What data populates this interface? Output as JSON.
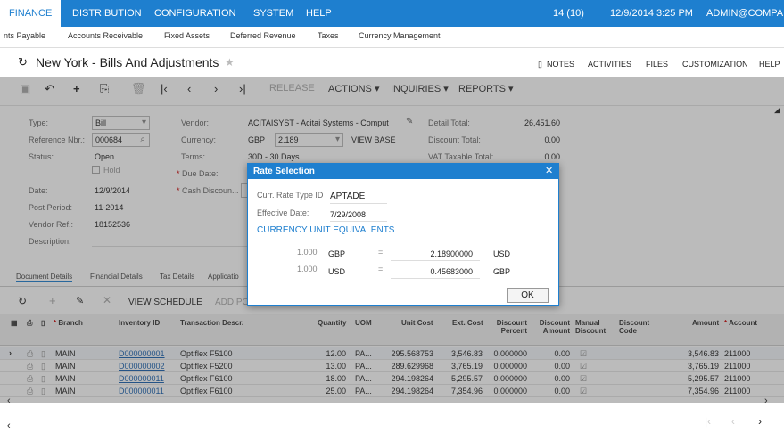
{
  "topbar": {
    "menus": [
      "FINANCE",
      "DISTRIBUTION",
      "CONFIGURATION",
      "SYSTEM",
      "HELP"
    ],
    "counter": "14 (10)",
    "datetime": "12/9/2014  3:25 PM",
    "user": "ADMIN@COMPAN"
  },
  "subtabs": [
    "nts Payable",
    "Accounts Receivable",
    "Fixed Assets",
    "Deferred Revenue",
    "Taxes",
    "Currency Management"
  ],
  "title": {
    "text": "New York - Bills And Adjustments",
    "right_links": [
      "NOTES",
      "ACTIVITIES",
      "FILES",
      "CUSTOMIZATION",
      "HELP"
    ]
  },
  "toolbar": {
    "release": "RELEASE",
    "actions": "ACTIONS",
    "inquiries": "INQUIRIES",
    "reports": "REPORTS"
  },
  "form": {
    "type_label": "Type:",
    "type_value": "Bill",
    "ref_label": "Reference Nbr.:",
    "ref_value": "000684",
    "status_label": "Status:",
    "status_value": "Open",
    "hold_label": "Hold",
    "date_label": "Date:",
    "date_value": "12/9/2014",
    "post_label": "Post Period:",
    "post_value": "11-2014",
    "vendorref_label": "Vendor Ref.:",
    "vendorref_value": "18152536",
    "desc_label": "Description:",
    "vendor_label": "Vendor:",
    "vendor_value": "ACITAISYST - Acitai Systems - Comput",
    "currency_label": "Currency:",
    "currency_value": "GBP",
    "rate_value": "2.189",
    "view_base": "VIEW BASE",
    "terms_label": "Terms:",
    "terms_value": "30D - 30 Days",
    "due_label": "Due Date:",
    "cash_label": "Cash Discoun...",
    "detail_total_label": "Detail Total:",
    "detail_total_value": "26,451.60",
    "discount_total_label": "Discount Total:",
    "discount_total_value": "0.00",
    "vat_label": "VAT Taxable Total:",
    "vat_value": "0.00"
  },
  "tabs": [
    "Document Details",
    "Financial Details",
    "Tax Details",
    "Applicatio"
  ],
  "gridtool": {
    "view_schedule": "VIEW SCHEDULE",
    "add_po": "ADD PO"
  },
  "grid": {
    "headers": {
      "branch": "Branch",
      "inventory": "Inventory ID",
      "trans": "Transaction Descr.",
      "qty": "Quantity",
      "uom": "UOM",
      "unit_cost": "Unit Cost",
      "ext_cost": "Ext. Cost",
      "disc_pct": "Discount Percent",
      "disc_amt": "Discount Amount",
      "manual": "Manual Discount",
      "disc_code": "Discount Code",
      "amount": "Amount",
      "account": "Account"
    },
    "rows": [
      {
        "branch": "MAIN",
        "inv": "D000000001",
        "descr": "Optiflex F5100",
        "qty": "12.00",
        "uom": "PA...",
        "unit": "295.568753",
        "ext": "3,546.83",
        "pct": "0.000000",
        "damt": "0.00",
        "amount": "3,546.83",
        "account": "211000"
      },
      {
        "branch": "MAIN",
        "inv": "D000000002",
        "descr": "Optiflex F5200",
        "qty": "13.00",
        "uom": "PA...",
        "unit": "289.629968",
        "ext": "3,765.19",
        "pct": "0.000000",
        "damt": "0.00",
        "amount": "3,765.19",
        "account": "211000"
      },
      {
        "branch": "MAIN",
        "inv": "D000000011",
        "descr": "Optiflex F6100",
        "qty": "18.00",
        "uom": "PA...",
        "unit": "294.198264",
        "ext": "5,295.57",
        "pct": "0.000000",
        "damt": "0.00",
        "amount": "5,295.57",
        "account": "211000"
      },
      {
        "branch": "MAIN",
        "inv": "D000000011",
        "descr": "Optiflex F6100",
        "qty": "25.00",
        "uom": "PA...",
        "unit": "294.198264",
        "ext": "7,354.96",
        "pct": "0.000000",
        "damt": "0.00",
        "amount": "7,354.96",
        "account": "211000"
      }
    ]
  },
  "dialog": {
    "title": "Rate Selection",
    "rate_type_label": "Curr. Rate Type ID",
    "rate_type_value": "APTADE",
    "eff_date_label": "Effective Date:",
    "eff_date_value": "7/29/2008",
    "section": "CURRENCY UNIT EQUIVALENTS",
    "rows": [
      {
        "unit": "1.000",
        "from": "GBP",
        "eq": "=",
        "rate": "2.18900000",
        "to": "USD"
      },
      {
        "unit": "1.000",
        "from": "USD",
        "eq": "=",
        "rate": "0.45683000",
        "to": "GBP"
      }
    ],
    "ok": "OK"
  },
  "colors": {
    "accent": "#1e7fcf"
  }
}
